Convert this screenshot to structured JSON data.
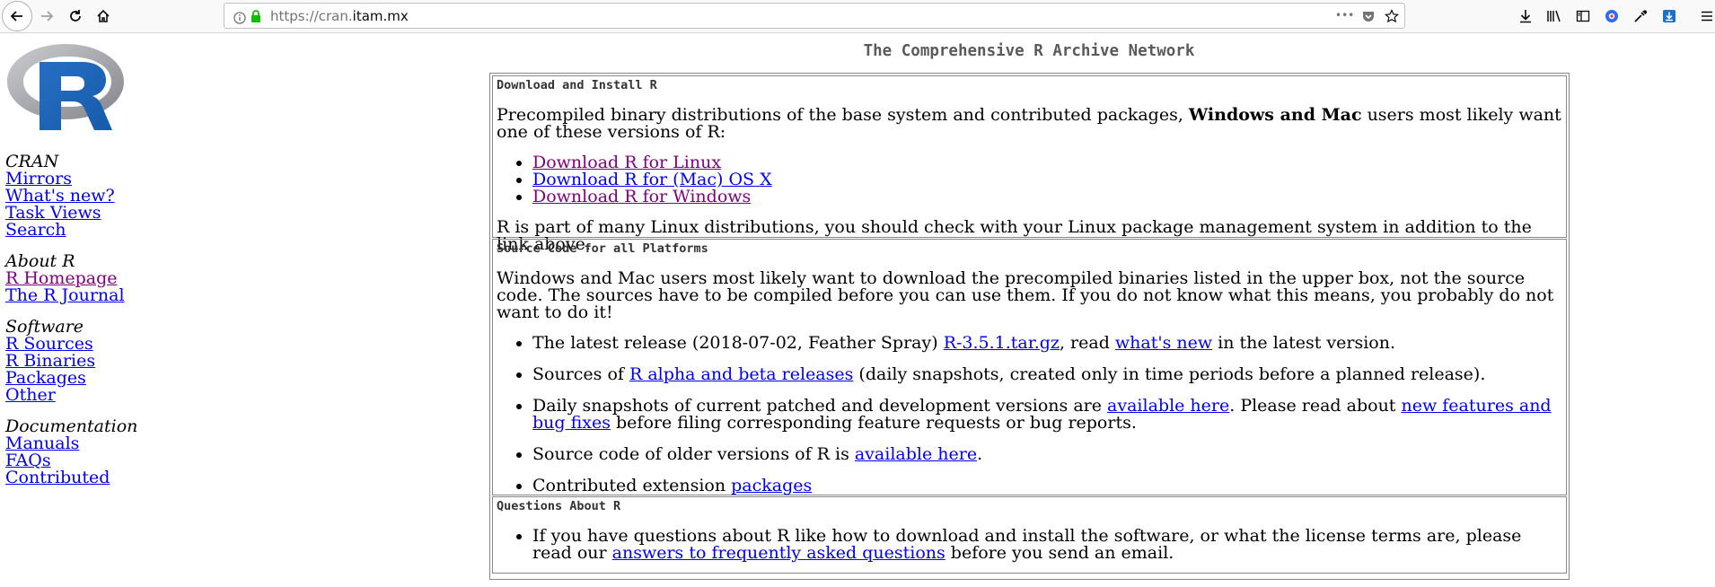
{
  "browser": {
    "url_scheme": "https://cran.",
    "url_host": "itam.mx",
    "url_more": "•••"
  },
  "page": {
    "site_title": "The Comprehensive R Archive Network"
  },
  "sidebar": {
    "cran": {
      "heading": "CRAN",
      "links": [
        "Mirrors",
        "What's new?",
        "Task Views",
        "Search"
      ]
    },
    "about": {
      "heading": "About R",
      "links": [
        "R Homepage",
        "The R Journal"
      ]
    },
    "software": {
      "heading": "Software",
      "links": [
        "R Sources",
        "R Binaries",
        "Packages",
        "Other"
      ]
    },
    "documentation": {
      "heading": "Documentation",
      "links": [
        "Manuals",
        "FAQs",
        "Contributed"
      ]
    }
  },
  "download": {
    "title": "Download and Install R",
    "intro_pre": "Precompiled binary distributions of the base system and contributed packages, ",
    "intro_bold": "Windows and Mac",
    "intro_post": " users most likely want one of these versions of R:",
    "links": [
      "Download R for Linux",
      "Download R for (Mac) OS X",
      "Download R for Windows"
    ],
    "outro": "R is part of many Linux distributions, you should check with your Linux package management system in addition to the link above."
  },
  "source": {
    "title": "Source Code for all Platforms",
    "intro": "Windows and Mac users most likely want to download the precompiled binaries listed in the upper box, not the source code. The sources have to be compiled before you can use them. If you do not know what this means, you probably do not want to do it!",
    "item1_pre": "The latest release (2018-07-02, Feather Spray) ",
    "item1_link1": "R-3.5.1.tar.gz",
    "item1_mid": ", read ",
    "item1_link2": "what's new",
    "item1_post": " in the latest version.",
    "item2_pre": "Sources of ",
    "item2_link": "R alpha and beta releases",
    "item2_post": " (daily snapshots, created only in time periods before a planned release).",
    "item3_pre": "Daily snapshots of current patched and development versions are ",
    "item3_link1": "available here",
    "item3_mid": ". Please read about ",
    "item3_link2": "new features and bug fixes",
    "item3_post": " before filing corresponding feature requests or bug reports.",
    "item4_pre": "Source code of older versions of R is ",
    "item4_link": "available here",
    "item4_post": ".",
    "item5_pre": "Contributed extension ",
    "item5_link": "packages"
  },
  "questions": {
    "title": "Questions About R",
    "item_pre": "If you have questions about R like how to download and install the software, or what the license terms are, please read our ",
    "item_link": "answers to frequently asked questions",
    "item_post": " before you send an email."
  },
  "colors": {
    "link": "#0000ee",
    "visited_link": "#800080",
    "r_logo_blue": "#276dc3",
    "r_logo_gray": "#a0a0a4"
  },
  "icons": [
    "back-arrow-icon",
    "forward-arrow-icon",
    "reload-icon",
    "home-icon",
    "info-icon",
    "lock-icon",
    "more-icon",
    "pocket-icon",
    "bookmark-star-icon",
    "download-icon",
    "library-icon",
    "sidebar-icon",
    "extension-icon",
    "eyedropper-icon",
    "download-arrow-blue-icon",
    "menu-icon"
  ]
}
